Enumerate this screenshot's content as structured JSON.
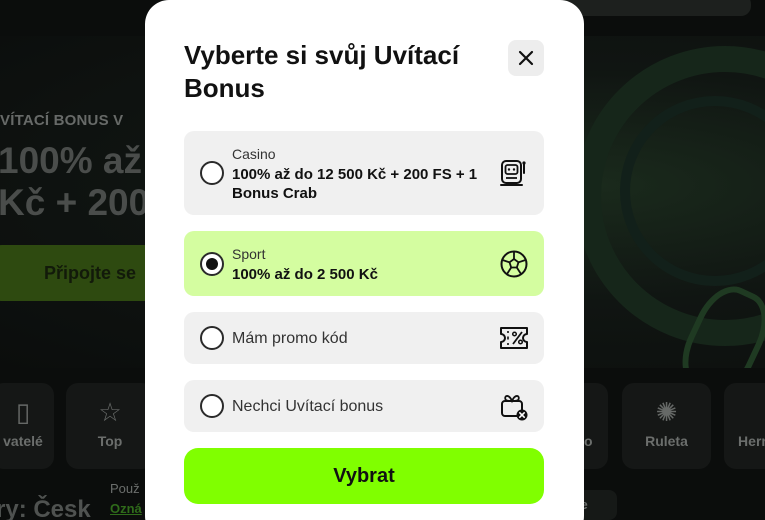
{
  "background": {
    "kicker": "VÍTACÍ BONUS V",
    "hero_title_line1": "100% až",
    "hero_title_line2": "Kč + 200",
    "cta_label": "Připojte se",
    "categories": [
      {
        "label": "vatelé",
        "icon": "users-icon"
      },
      {
        "label": "Top",
        "icon": "star-icon"
      },
      {
        "label": "no",
        "icon": "casino-icon"
      },
      {
        "label": "Ruleta",
        "icon": "roulette-icon"
      },
      {
        "label": "Hern",
        "icon": "games-icon"
      }
    ],
    "section_title": "ry: Česk",
    "small_text_line1": "Použ",
    "small_link": "Ozná",
    "chip_label": "yše"
  },
  "modal": {
    "title": "Vyberte si svůj Uvítací Bonus",
    "close_icon": "close-icon",
    "options": [
      {
        "category": "Casino",
        "description": "100% až do 12 500 Kč + 200 FS + 1 Bonus Crab",
        "icon": "slot-machine-icon",
        "selected": false
      },
      {
        "category": "Sport",
        "description": "100% až do 2 500 Kč",
        "icon": "soccer-ball-icon",
        "selected": true
      },
      {
        "label": "Mám promo kód",
        "icon": "percent-ticket-icon",
        "selected": false
      },
      {
        "label": "Nechci Uvítací bonus",
        "icon": "gift-cancel-icon",
        "selected": false
      }
    ],
    "submit_label": "Vybrat"
  },
  "colors": {
    "accent": "#80ff00",
    "selected_bg": "#d4fda0",
    "option_bg": "#f0f0f0"
  }
}
